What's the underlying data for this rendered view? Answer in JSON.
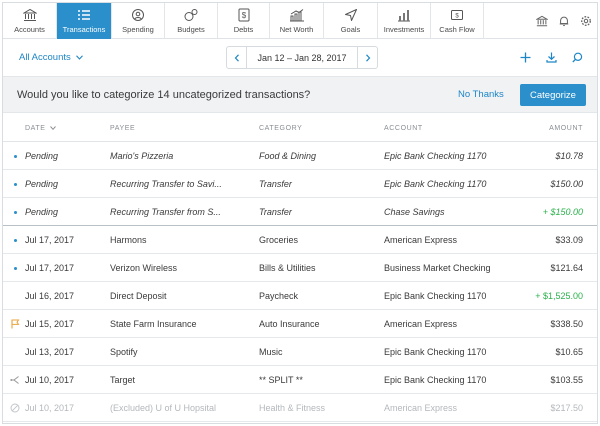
{
  "nav": {
    "items": [
      {
        "label": "Accounts",
        "icon": "bank-icon"
      },
      {
        "label": "Transactions",
        "icon": "list-icon",
        "active": true
      },
      {
        "label": "Spending",
        "icon": "spending-icon"
      },
      {
        "label": "Budgets",
        "icon": "budgets-icon"
      },
      {
        "label": "Debts",
        "icon": "debts-icon"
      },
      {
        "label": "Net Worth",
        "icon": "net-worth-icon"
      },
      {
        "label": "Goals",
        "icon": "goals-icon"
      },
      {
        "label": "Investments",
        "icon": "investments-icon"
      },
      {
        "label": "Cash Flow",
        "icon": "cash-flow-icon"
      }
    ],
    "right_icons": [
      "bank-icon",
      "bell-icon",
      "gear-icon"
    ]
  },
  "toolbar": {
    "account_filter": "All Accounts",
    "date_range": "Jan 12 – Jan 28, 2017"
  },
  "banner": {
    "question": "Would you like to categorize 14 uncategorized transactions?",
    "dismiss_label": "No Thanks",
    "categorize_label": "Categorize"
  },
  "table": {
    "headers": {
      "date": "DATE",
      "payee": "PAYEE",
      "category": "CATEGORY",
      "account": "ACCOUNT",
      "amount": "AMOUNT"
    },
    "rows": [
      {
        "date": "Pending",
        "payee": "Mario's Pizzeria",
        "category": "Food & Dining",
        "account": "Epic Bank Checking 1170",
        "amount": "$10.78",
        "pending": true,
        "marker": "dot"
      },
      {
        "date": "Pending",
        "payee": "Recurring Transfer to Savi...",
        "category": "Transfer",
        "account": "Epic Bank Checking 1170",
        "amount": "$150.00",
        "pending": true,
        "marker": "dot"
      },
      {
        "date": "Pending",
        "payee": "Recurring Transfer from S...",
        "category": "Transfer",
        "account": "Chase Savings",
        "amount": "+ $150.00",
        "pending": true,
        "marker": "dot",
        "positive": true
      },
      {
        "date": "Jul 17, 2017",
        "payee": "Harmons",
        "category": "Groceries",
        "account": "American Express",
        "amount": "$33.09",
        "marker": "dot"
      },
      {
        "date": "Jul 17, 2017",
        "payee": "Verizon Wireless",
        "category": "Bills & Utilities",
        "account": "Business Market Checking",
        "amount": "$121.64",
        "marker": "dot"
      },
      {
        "date": "Jul 16, 2017",
        "payee": "Direct Deposit",
        "category": "Paycheck",
        "account": "Epic Bank Checking 1170",
        "amount": "+ $1,525.00",
        "positive": true
      },
      {
        "date": "Jul 15, 2017",
        "payee": "State Farm Insurance",
        "category": "Auto Insurance",
        "account": "American Express",
        "amount": "$338.50",
        "marker": "flag"
      },
      {
        "date": "Jul 13, 2017",
        "payee": "Spotify",
        "category": "Music",
        "account": "Epic Bank Checking 1170",
        "amount": "$10.65"
      },
      {
        "date": "Jul 10, 2017",
        "payee": "Target",
        "category": "** SPLIT **",
        "account": "Epic Bank Checking 1170",
        "amount": "$103.55",
        "marker": "split"
      },
      {
        "date": "Jul 10, 2017",
        "payee": "(Excluded)   U of U Hopsital",
        "category": "Health & Fitness",
        "account": "American Express",
        "amount": "$217.50",
        "marker": "excluded",
        "excluded": true
      }
    ]
  },
  "colors": {
    "accent": "#2a8fcb",
    "positive": "#2bb24c",
    "flag": "#e8a33a"
  }
}
